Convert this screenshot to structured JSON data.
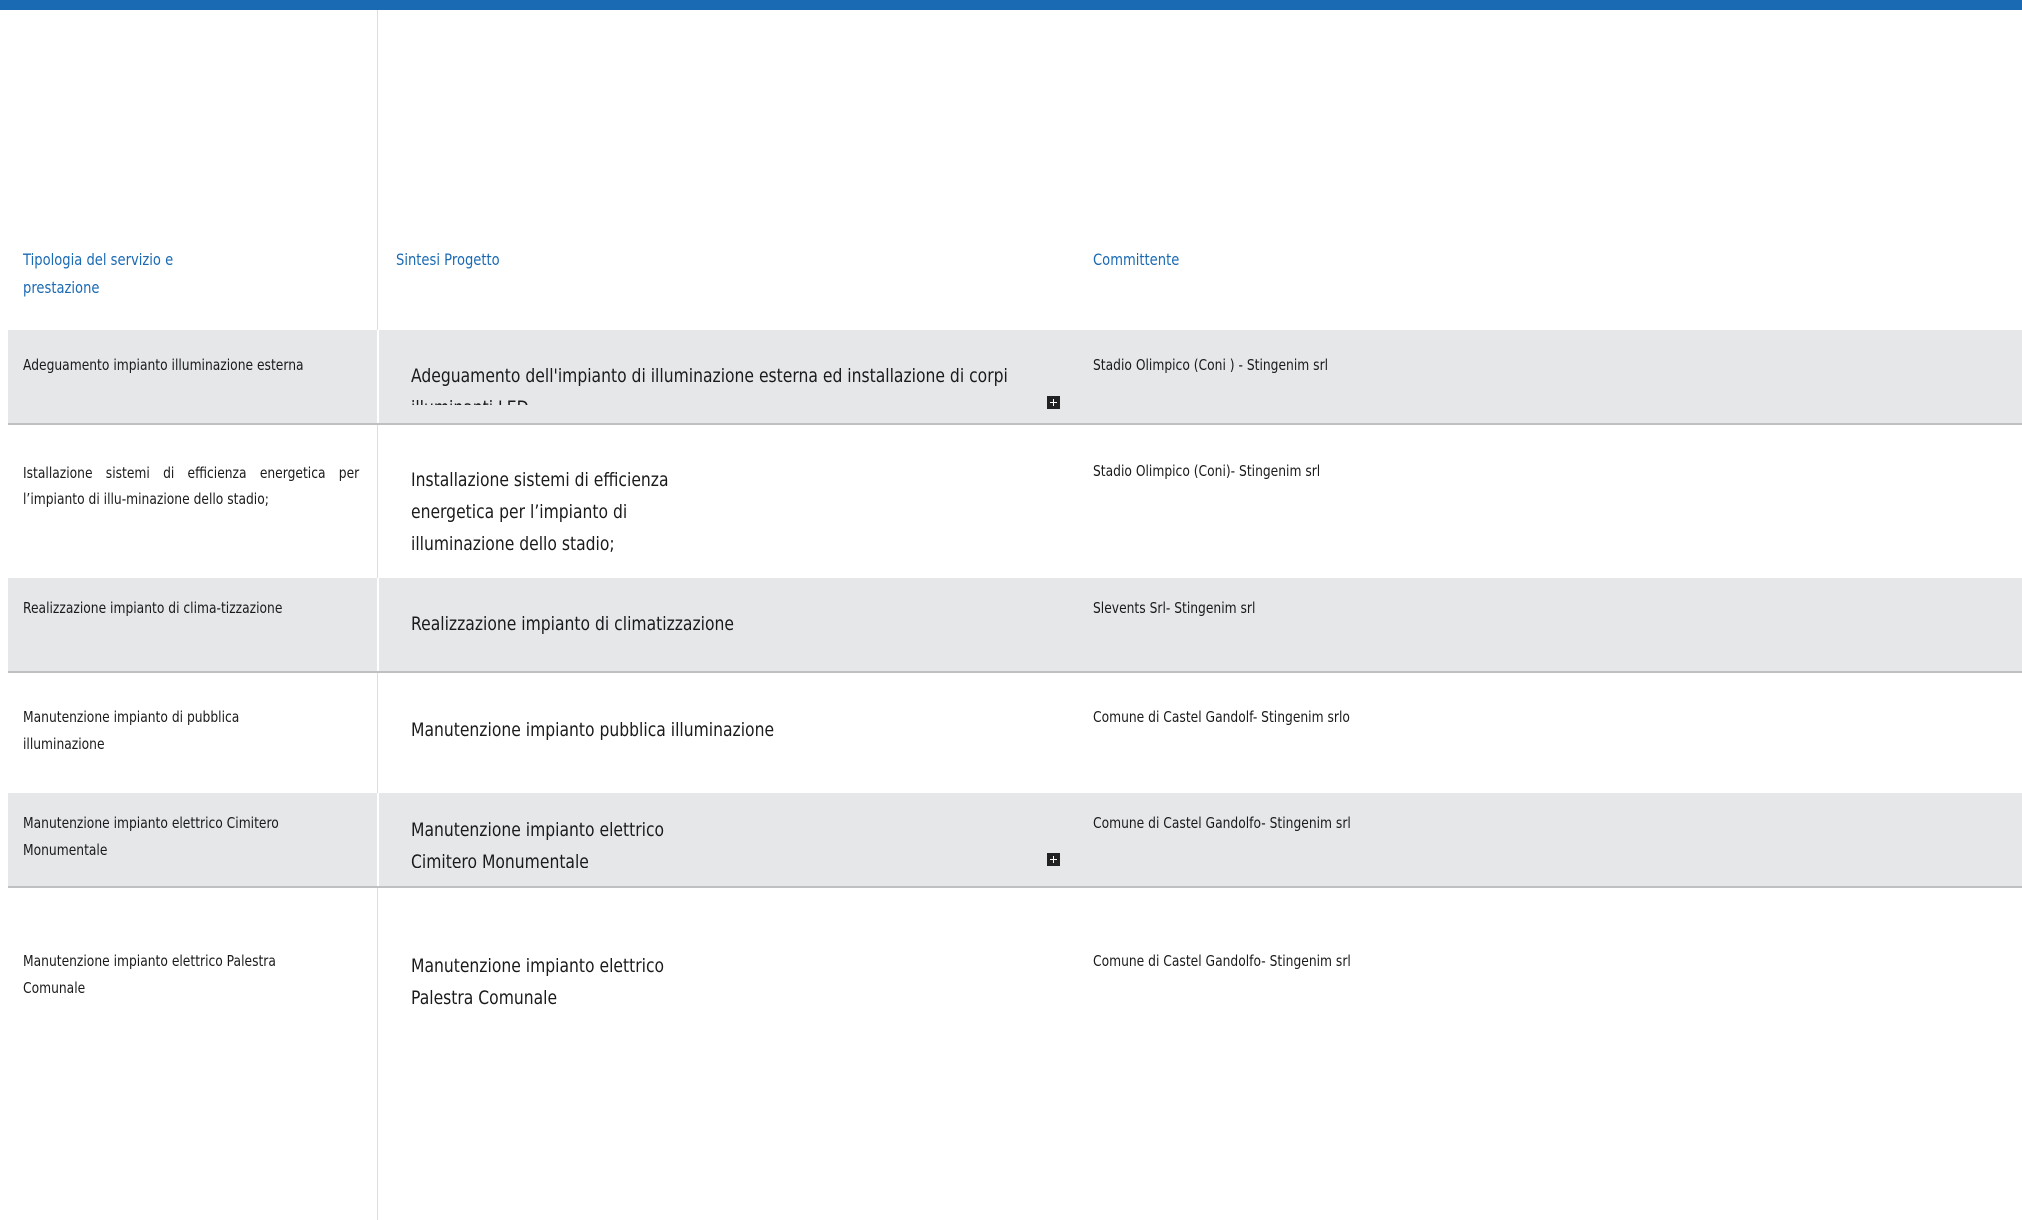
{
  "table": {
    "headers": {
      "tipologia": "Tipologia del servizio e prestazione",
      "sintesi": "Sintesi Progetto",
      "committente": "Committente"
    },
    "rows": [
      {
        "tipologia": "Adeguamento impianto illuminazione esterna",
        "sintesi": "Adeguamento dell'impianto di illuminazione esterna ed installazione di corpi illuminanti LED",
        "committente": "Stadio Olimpico (Coni ) - Stingenim srl"
      },
      {
        "tipologia": "Istallazione sistemi di efficienza energetica per l’impianto di illu-minazione dello stadio;",
        "sintesi": "Installazione sistemi di efficienza energetica per l’impianto di illuminazione dello stadio;",
        "committente": "Stadio Olimpico (Coni)- Stingenim srl"
      },
      {
        "tipologia": "Realizzazione impianto di clima-tizzazione",
        "sintesi": "Realizzazione impianto di climatizzazione",
        "committente": "Slevents Srl- Stingenim srl"
      },
      {
        "tipologia": "Manutenzione impianto di pubblica illuminazione",
        "sintesi": "Manutenzione impianto pubblica illuminazione",
        "committente": "Comune di Castel Gandolf- Stingenim srlo"
      },
      {
        "tipologia": "Manutenzione impianto elettrico Cimitero Monumentale",
        "sintesi": "Manutenzione impianto elettrico Cimitero Monumentale",
        "committente": "Comune di Castel Gandolfo- Stingenim srl"
      },
      {
        "tipologia": "Manutenzione impianto elettrico Palestra Comunale",
        "sintesi": "Manutenzione impianto elettrico Palestra Comunale",
        "committente": "Comune di Castel Gandolfo- Stingenim srl"
      }
    ]
  },
  "colors": {
    "accent": "#1a6ab3",
    "row_shade": "#e6e7e9",
    "divider": "#bfc0c2"
  },
  "icons": {
    "expand": "plus-square-icon"
  }
}
